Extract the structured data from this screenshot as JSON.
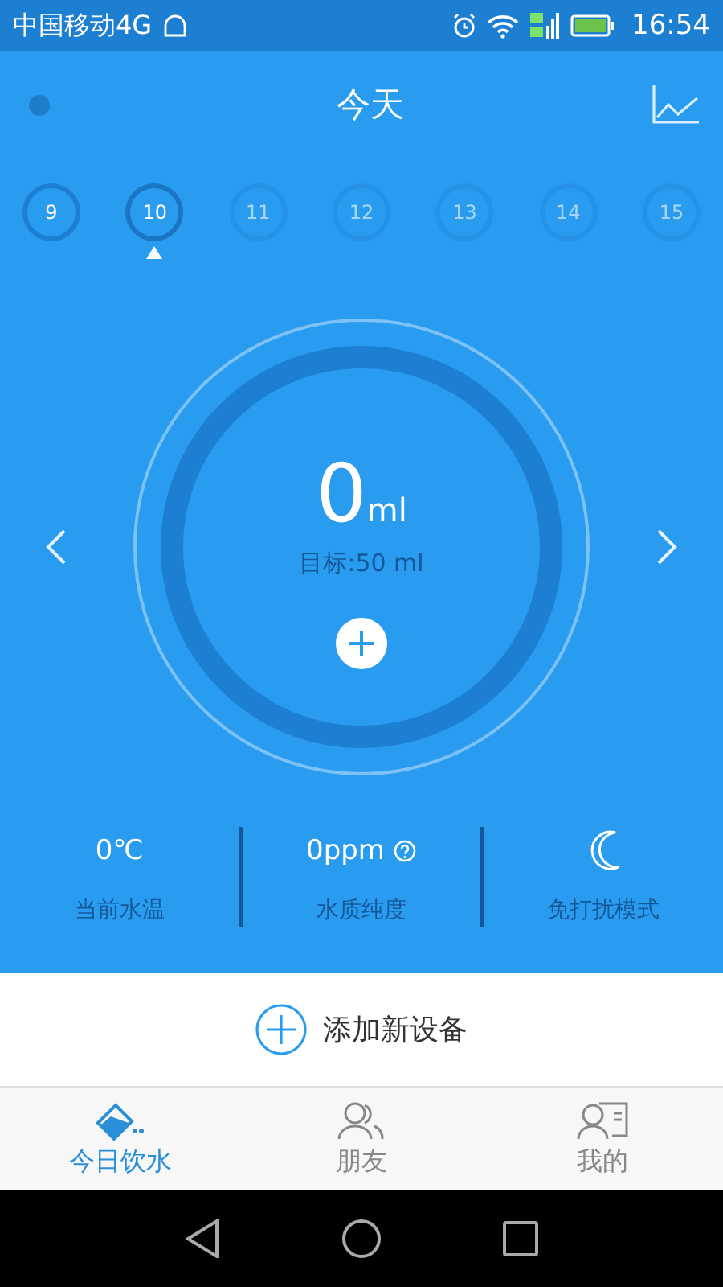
{
  "status_bar": {
    "carrier": "中国移动4G",
    "time": "16:54"
  },
  "header": {
    "title": "今天"
  },
  "days": [
    {
      "label": "9",
      "selected": false,
      "disabled": false
    },
    {
      "label": "10",
      "selected": true,
      "disabled": false
    },
    {
      "label": "11",
      "selected": false,
      "disabled": true
    },
    {
      "label": "12",
      "selected": false,
      "disabled": true
    },
    {
      "label": "13",
      "selected": false,
      "disabled": true
    },
    {
      "label": "14",
      "selected": false,
      "disabled": true
    },
    {
      "label": "15",
      "selected": false,
      "disabled": true
    }
  ],
  "intake": {
    "amount": "0",
    "unit": "ml",
    "goal": "目标:50 ml"
  },
  "stats": [
    {
      "kind": "value",
      "value": "0℃",
      "label": "当前水温"
    },
    {
      "kind": "help",
      "value": "0ppm",
      "label": "水质纯度"
    },
    {
      "kind": "moon",
      "label": "免打扰模式"
    }
  ],
  "add_device": {
    "label": "添加新设备"
  },
  "tabs": [
    {
      "label": "今日饮水",
      "kind": "water",
      "selected": true
    },
    {
      "label": "朋友",
      "kind": "friends",
      "selected": false
    },
    {
      "label": "我的",
      "kind": "profile",
      "selected": false
    }
  ]
}
